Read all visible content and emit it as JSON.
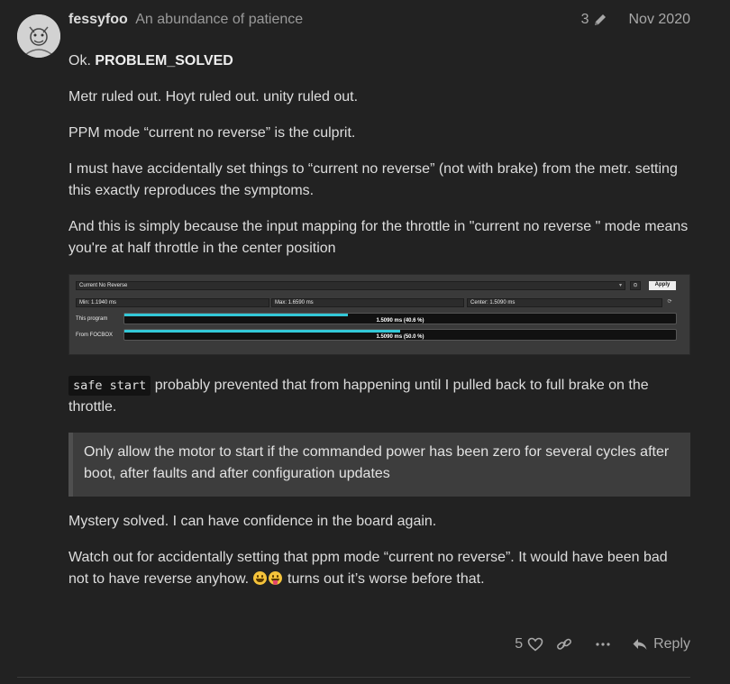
{
  "post": {
    "username": "fessyfoo",
    "user_title": "An abundance of patience",
    "edit_count": "3",
    "date": "Nov 2020"
  },
  "content": {
    "p1_prefix": "Ok. ",
    "p1_bold": "PROBLEM_SOLVED",
    "p2": "Metr ruled out. Hoyt ruled out. unity ruled out.",
    "p3": "PPM mode “current no reverse” is the culprit.",
    "p4": "I must have accidentally set things to “current no reverse” (not with brake) from the metr. setting this exactly reproduces the symptoms.",
    "p5": "And this is simply because the input mapping for the throttle in \"current no reverse \" mode means you're at half throttle in the center position",
    "code": "safe start",
    "p6_rest": " probably prevented that from happening until I pulled back to full brake on the throttle.",
    "quote": "Only allow the motor to start if the commanded power has been zero for several cycles after boot, after faults and after configuration updates",
    "p7": "Mystery solved. I can have confidence in the board again.",
    "p8_a": "Watch out for accidentally setting that ppm mode “current no reverse”. It would have been bad not to have reverse anyhow. ",
    "p8_b": " turns out it’s worse before that."
  },
  "screenshot": {
    "mode": "Current No Reverse",
    "apply": "Apply",
    "min": "Min: 1.1940 ms",
    "max": "Max: 1.6590 ms",
    "center": "Center: 1.5090 ms",
    "row1_label": "This program",
    "row1_value": "1.5090 ms (40.6 %)",
    "row1_fraction": 0.406,
    "row2_label": "From FOCBOX",
    "row2_value": "1.5090 ms (50.0 %)",
    "row2_fraction": 0.5
  },
  "actions": {
    "like_count": "5",
    "reply_label": "Reply"
  },
  "icons": [
    "pencil-icon",
    "heart-icon",
    "link-icon",
    "more-icon",
    "reply-icon",
    "grinning-emoji",
    "tongue-emoji"
  ],
  "colors": {
    "background": "#222222",
    "accent_bar": "#33c8d8",
    "quote_bg": "#3d3d3d"
  }
}
